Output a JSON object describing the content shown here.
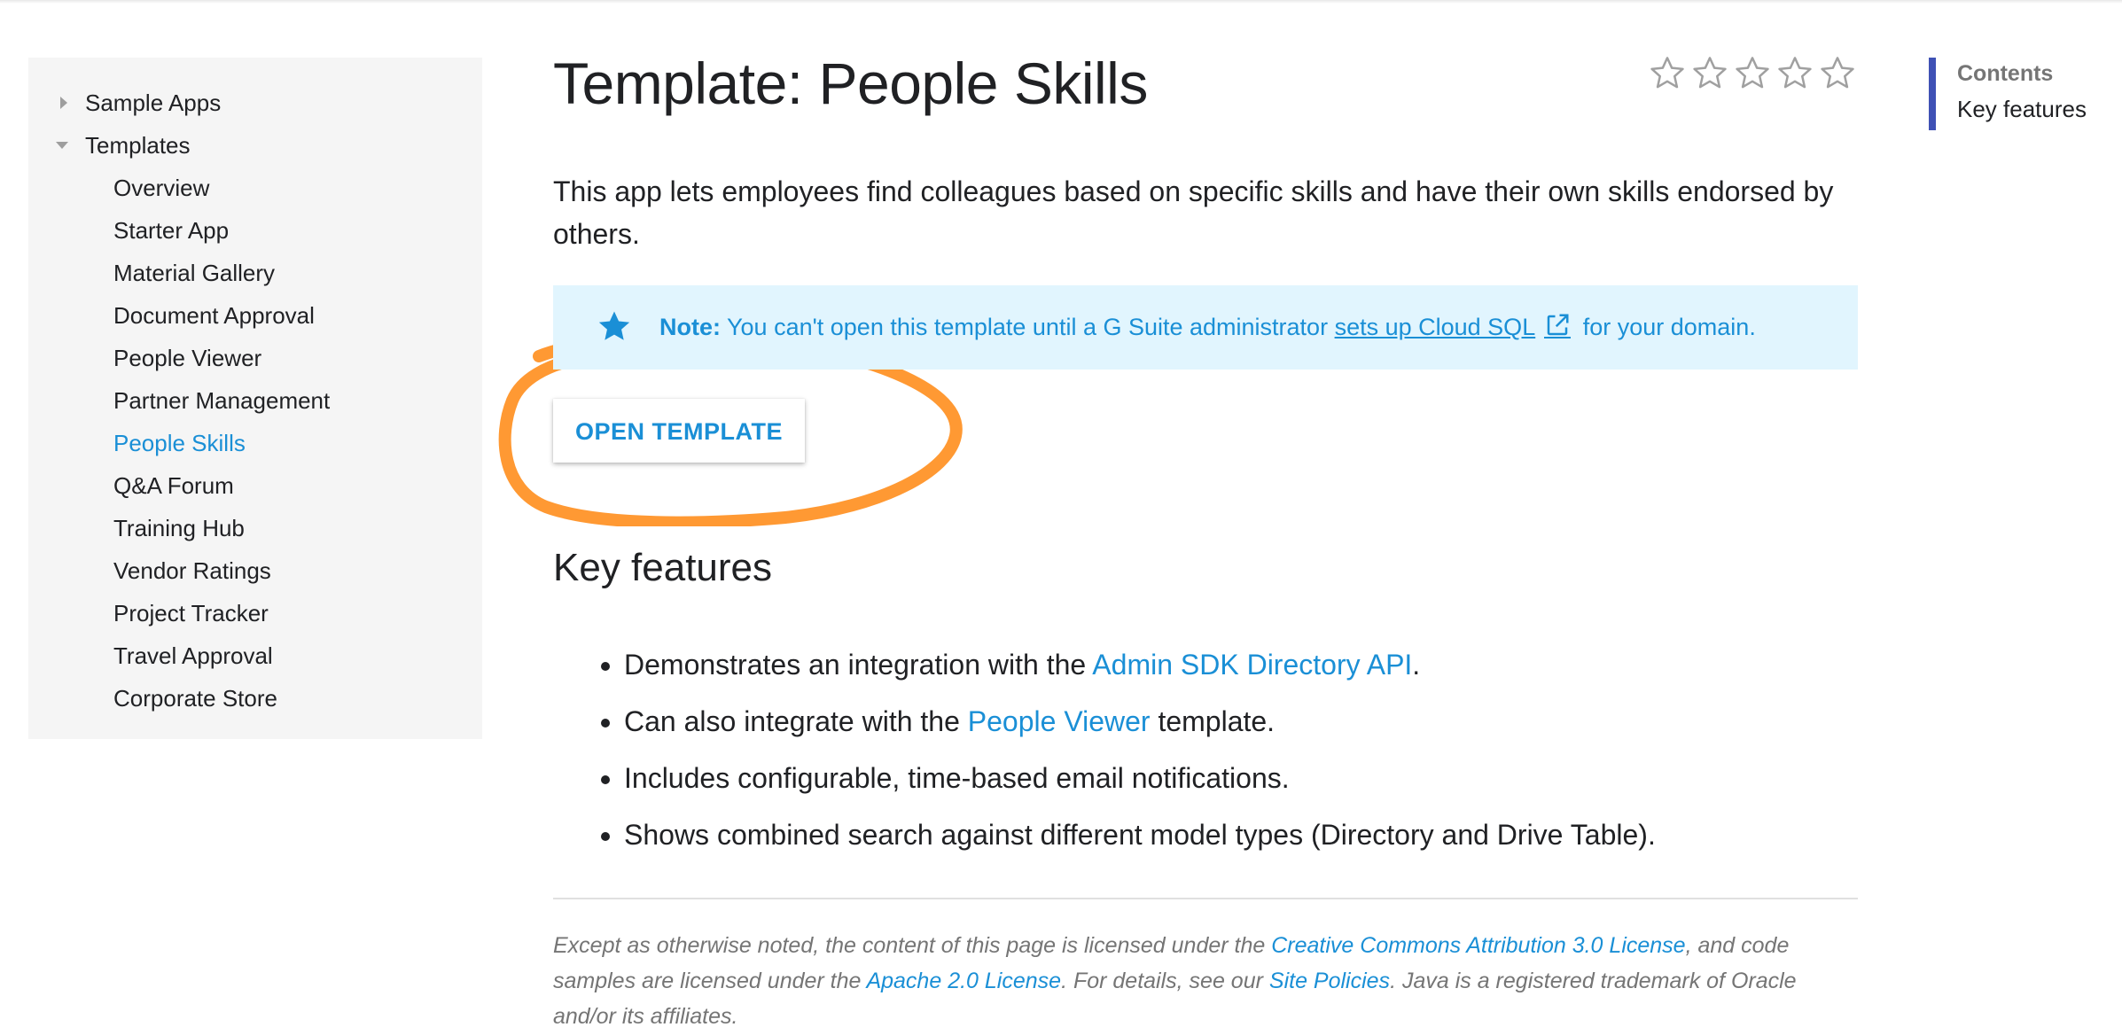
{
  "sidebar": {
    "items": [
      {
        "label": "Sample Apps",
        "expanded": false
      },
      {
        "label": "Templates",
        "expanded": true
      }
    ],
    "templates": [
      "Overview",
      "Starter App",
      "Material Gallery",
      "Document Approval",
      "People Viewer",
      "Partner Management",
      "People Skills",
      "Q&A Forum",
      "Training Hub",
      "Vendor Ratings",
      "Project Tracker",
      "Travel Approval",
      "Corporate Store"
    ],
    "active_item": "People Skills"
  },
  "page": {
    "title": "Template: People Skills",
    "rating_stars": 5,
    "rating_value": 0,
    "intro": "This app lets employees find colleagues based on specific skills and have their own skills endorsed by others."
  },
  "note": {
    "label": "Note:",
    "text_before": "You can't open this template until a G Suite administrator",
    "link_text": "sets up Cloud SQL",
    "text_after": "for your domain."
  },
  "open_button": {
    "label": "OPEN TEMPLATE"
  },
  "key_features": {
    "heading": "Key features",
    "items": [
      {
        "before": "Demonstrates an integration with the ",
        "link": "Admin SDK Directory API",
        "after": "."
      },
      {
        "before": "Can also integrate with the ",
        "link": "People Viewer",
        "after": " template."
      },
      {
        "before": "Includes configurable, time-based email notifications.",
        "link": "",
        "after": ""
      },
      {
        "before": "Shows combined search against different model types (Directory and Drive Table).",
        "link": "",
        "after": ""
      }
    ]
  },
  "footer": {
    "t1": "Except as otherwise noted, the content of this page is licensed under the ",
    "l1": "Creative Commons Attribution 3.0 License",
    "t2": ", and code samples are licensed under the ",
    "l2": "Apache 2.0 License",
    "t3": ". For details, see our ",
    "l3": "Site Policies",
    "t4": ". Java is a registered trademark of Oracle and/or its affiliates."
  },
  "toc": {
    "heading": "Contents",
    "items": [
      "Key features"
    ]
  },
  "colors": {
    "accent": "#1a8fd6",
    "note_background": "#e1f5fe",
    "highlight_ring": "#ff9933",
    "toc_bar": "#3f51b5",
    "sidebar_background": "#f5f5f5"
  },
  "icons": {
    "note": "star-icon",
    "external_link": "external-link-icon",
    "rating": "star-outline-icon",
    "collapsed": "triangle-right-icon",
    "expanded": "triangle-down-icon"
  }
}
